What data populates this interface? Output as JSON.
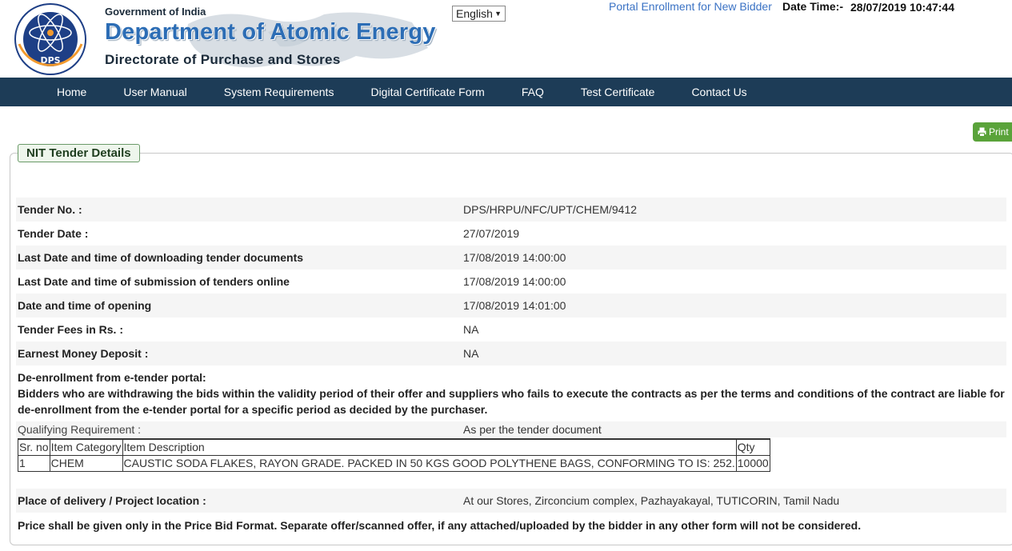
{
  "header": {
    "logo_text": "क्र भं नि DPS",
    "gov": "Government of India",
    "department": "Department of Atomic Energy",
    "directorate": "Directorate of Purchase and Stores",
    "language": "English",
    "portal_link": "Portal Enrollment for New Bidder",
    "date_label": "Date Time:-",
    "date_value": "28/07/2019 10:47:44"
  },
  "nav": {
    "items": [
      "Home",
      "User Manual",
      "System Requirements",
      "Digital Certificate Form",
      "FAQ",
      "Test Certificate",
      "Contact Us"
    ]
  },
  "print_label": "Print",
  "section_title": "NIT Tender Details",
  "details": [
    {
      "label": "Tender No. :",
      "value": "DPS/HRPU/NFC/UPT/CHEM/9412"
    },
    {
      "label": "Tender Date :",
      "value": "27/07/2019"
    },
    {
      "label": "Last Date and time of downloading tender documents",
      "value": "17/08/2019 14:00:00"
    },
    {
      "label": "Last Date and time of submission of tenders online",
      "value": "17/08/2019 14:00:00"
    },
    {
      "label": "Date and time of opening",
      "value": "17/08/2019 14:01:00"
    },
    {
      "label": "Tender Fees in Rs. :",
      "value": "NA"
    },
    {
      "label": "Earnest Money Deposit :",
      "value": "NA"
    }
  ],
  "deenrollment": {
    "title": "De-enrollment from e-tender portal:",
    "text": "Bidders who are withdrawing the bids within the validity period of their offer and suppliers who fails to execute the contracts as per the terms and conditions of the contract are liable for de-enrollment from the e-tender portal for a specific period as decided by the purchaser."
  },
  "qualifying": {
    "label": "Qualifying Requirement :",
    "value": "As per the tender document"
  },
  "items_table": {
    "headers": [
      "Sr. no",
      "Item Category",
      "Item Description",
      "Qty"
    ],
    "rows": [
      [
        "1",
        "CHEM",
        "CAUSTIC SODA FLAKES, RAYON GRADE. PACKED IN 50 KGS GOOD POLYTHENE BAGS, CONFORMING TO IS: 252.",
        "10000"
      ]
    ]
  },
  "delivery": {
    "label": "Place of delivery / Project location :",
    "value": "At our Stores, Zirconcium complex, Pazhayakayal, TUTICORIN, Tamil Nadu"
  },
  "price_note": "Price shall be given only in the Price Bid Format. Separate offer/scanned offer, if any attached/uploaded by the bidder in any other form will not be considered."
}
